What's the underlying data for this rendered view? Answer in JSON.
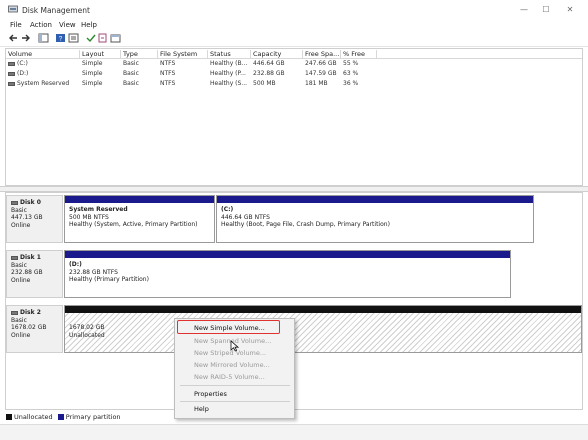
{
  "window": {
    "title": "Disk Management",
    "minimize": "—",
    "maximize": "☐",
    "close": "✕"
  },
  "menubar": [
    "File",
    "Action",
    "View",
    "Help"
  ],
  "toolbar": {
    "icons": [
      "back-icon",
      "forward-icon",
      "console-tree-icon",
      "help-icon",
      "properties-icon",
      "check-icon",
      "new-icon",
      "export-icon"
    ]
  },
  "volume_table": {
    "columns": [
      "Volume",
      "Layout",
      "Type",
      "File System",
      "Status",
      "Capacity",
      "Free Spa...",
      "% Free"
    ],
    "rows": [
      [
        "(C:)",
        "Simple",
        "Basic",
        "NTFS",
        "Healthy (B...",
        "446.64 GB",
        "247.66 GB",
        "55 %"
      ],
      [
        "(D:)",
        "Simple",
        "Basic",
        "NTFS",
        "Healthy (P...",
        "232.88 GB",
        "147.59 GB",
        "63 %"
      ],
      [
        "System Reserved",
        "Simple",
        "Basic",
        "NTFS",
        "Healthy (S...",
        "500 MB",
        "181 MB",
        "36 %"
      ]
    ]
  },
  "disks": [
    {
      "name": "Disk 0",
      "type": "Basic",
      "size": "447.13 GB",
      "state": "Online",
      "partitions": [
        {
          "title": "System Reserved",
          "line1": "500 MB NTFS",
          "line2": "Healthy (System, Active, Primary Partition)"
        },
        {
          "title": "(C:)",
          "line1": "446.64 GB NTFS",
          "line2": "Healthy (Boot, Page File, Crash Dump, Primary Partition)"
        }
      ]
    },
    {
      "name": "Disk 1",
      "type": "Basic",
      "size": "232.88 GB",
      "state": "Online",
      "partitions": [
        {
          "title": "(D:)",
          "line1": "232.88 GB NTFS",
          "line2": "Healthy (Primary Partition)"
        }
      ]
    },
    {
      "name": "Disk 2",
      "type": "Basic",
      "size": "1678.02 GB",
      "state": "Online",
      "partitions": [
        {
          "title": "",
          "line1": "1678.02 GB",
          "line2": "Unallocated"
        }
      ]
    }
  ],
  "context_menu": {
    "items": [
      {
        "label": "New Simple Volume...",
        "enabled": true,
        "highlighted": true
      },
      {
        "label": "New Spanned Volume...",
        "enabled": false
      },
      {
        "label": "New Striped Volume...",
        "enabled": false
      },
      {
        "label": "New Mirrored Volume...",
        "enabled": false
      },
      {
        "label": "New RAID-5 Volume...",
        "enabled": false
      },
      {
        "label": "Properties",
        "enabled": true
      },
      {
        "label": "Help",
        "enabled": true
      }
    ]
  },
  "legend": [
    {
      "label": "Unallocated",
      "color": "#111111"
    },
    {
      "label": "Primary partition",
      "color": "#1a1a8c"
    }
  ],
  "colors": {
    "primary_partition": "#1a1a8c",
    "unallocated": "#111111",
    "highlight_border": "#e0322f"
  }
}
